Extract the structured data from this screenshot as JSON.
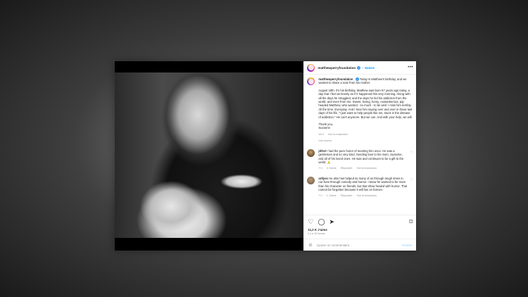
{
  "post": {
    "username": "matthewperryfoundation",
    "follow_label": "Suivre",
    "caption_lead": "Today is Matthew's birthday, and we wanted to share a note from his mother.",
    "letter": "August 19th. It's his birthday. Matthew was born 57 years ago today, a day that I feel as keenly as if it happened this very morning. Along with all the days he struggled, and the days he hid his addiction from the world, and even from me. Sweet, loving, funny, cantankerous, pig-headed Matthew, who wanted - so much - to be well. I miss him terribly. All the time. Everyday. And I hear him saying over and over in those last days of his life, \"I just want to help people like me, stuck in the disease of addiction.\" He can't anymore. But we can. And with your help, we will.",
    "signoff_1": "Thank you,",
    "signoff_2": "Suzanne",
    "caption_age": "18 h",
    "caption_translation": "Voir la traduction",
    "sources": "Voir source",
    "comments": [
      {
        "user": "jdOvt",
        "text": "I had the pure honor of meeting him once. He was a gentleman and so very kind. Sending love to his mom, Suzanne, and all of his loved ones. He was and continues to be a gift to the world. 🙏",
        "age": "7 h",
        "likes": "4 J'aime",
        "reply": "Répondre",
        "translation": "Voir la traduction"
      },
      {
        "user": "artlyss",
        "text": "He also has helped so many of us through tough times in our lives through comedy and humor. I know he wanted to be more than his character on friends, but that show healed with humor. That cannot be forgotten because it will live on forever.",
        "age": "7 h",
        "likes": "1 J'aime",
        "reply": "Répondre",
        "translation": "Voir la traduction"
      }
    ],
    "likes_count": "11,2 K J'aime",
    "date": "Il y a 18 heures",
    "comment_placeholder": "Ajouter un commentaire...",
    "publish_label": "Publier"
  }
}
